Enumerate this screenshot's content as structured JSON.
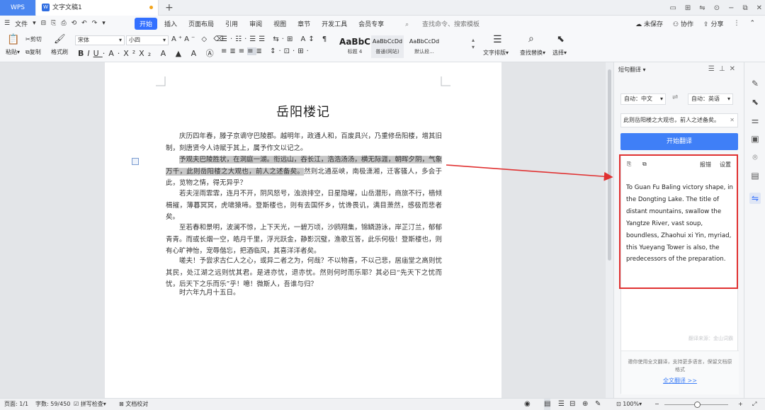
{
  "titlebar": {
    "wps_label": "WPS",
    "doc_tab_name": "文字文稿1",
    "new_tab": "+",
    "window_controls": [
      "▭",
      "⊞",
      "⇋",
      "⊙",
      "−",
      "⧉",
      "✕"
    ]
  },
  "menubar": {
    "file_menu": "文件",
    "quick": [
      "▾",
      "⊟",
      "⎘",
      "⎙",
      "⟲",
      "↶",
      "↷",
      "▾"
    ],
    "tabs": [
      "开始",
      "插入",
      "页面布局",
      "引用",
      "审阅",
      "视图",
      "章节",
      "开发工具",
      "会员专享"
    ],
    "search": "查找命令、搜索模板",
    "right": [
      "未保存",
      "协作",
      "分享"
    ]
  },
  "ribbon": {
    "paste": "粘贴",
    "cut": "剪切",
    "copy": "复制",
    "format_painter": "格式刷",
    "font_name": "宋体",
    "font_size": "小四",
    "styles": [
      {
        "preview": "AaBbC",
        "name": "标题 4"
      },
      {
        "preview": "AaBbCcDd",
        "name": "普通(网站)"
      },
      {
        "preview": "AaBbCcDd",
        "name": "默认段..."
      }
    ],
    "text_layout": "文字排版",
    "find_replace": "查找替换",
    "select": "选择"
  },
  "document": {
    "title": "岳阳楼记",
    "p1": "庆历四年春，滕子京谪守巴陵郡。越明年，政通人和，百废具兴，乃重修岳阳楼，增其旧制，刻唐贤今人诗赋于其上，属予作文以记之。",
    "p2_highlight": "予观夫巴陵胜状，在洞庭一湖。衔远山，吞长江，浩浩汤汤，横无际涯，朝晖夕阴，气象万千，此则岳阳楼之大观也，前人之述备矣。",
    "p2_rest": "然则北通巫峡，南极潇湘，迁客骚人，多会于此，览物之情，得无异乎？",
    "p3": "若夫淫雨霏霏，连月不开，阴风怒号，浊浪排空，日星隐曜，山岳潜形，商旅不行，樯倾楫摧，薄暮冥冥，虎啸猿啼。登斯楼也，则有去国怀乡，忧谗畏讥，满目萧然，感极而悲者矣。",
    "p4": "至若春和景明，波澜不惊，上下天光，一碧万顷，沙鸥翔集，锦鳞游泳，岸芷汀兰，郁郁青青。而或长烟一空，皓月千里，浮光跃金，静影沉璧，渔歌互答，此乐何极！登斯楼也，则有心旷神怡，宠辱偕忘，把酒临风，其喜洋洋者矣。",
    "p5": "嗟夫！予尝求古仁人之心，或异二者之为，何哉？不以物喜，不以己悲，居庙堂之高则忧其民，处江湖之远则忧其君。是进亦忧，退亦忧。然则何时而乐耶？其必曰“先天下之忧而忧，后天下之乐而乐”乎！噫！微斯人，吾谁与归？",
    "p6": "时六年九月十五日。"
  },
  "panel": {
    "title": "短句翻译",
    "source_lang": "自动：中文",
    "target_lang": "自动：英语",
    "swap": "⇌",
    "source_text": "此则岳阳楼之大观也，前人之述备矣。",
    "start_button": "开始翻译",
    "report": "报错",
    "settings": "设置",
    "result": "To Guan Fu Baling victory shape, in the Dongting Lake. The title of distant mountains, swallow the Yangtze River, vast soup, boundless, Zhaohui xi Yin, myriad, this Yueyang Tower is also, the predecessors of the preparation.",
    "source_credit": "翻译来源：金山词霸",
    "promo": "邀你使用全文翻译，支持更多语言，保留文档原格式",
    "promo_link": "全文翻译 >>"
  },
  "statusbar": {
    "page": "页面: 1/1",
    "words": "字数: 59/450",
    "spell": "拼写检查",
    "proof": "文档校对",
    "zoom": "100%"
  },
  "colors": {
    "accent": "#3370ff",
    "highlight": "#c7c7c7",
    "annotation_red": "#e03131"
  }
}
